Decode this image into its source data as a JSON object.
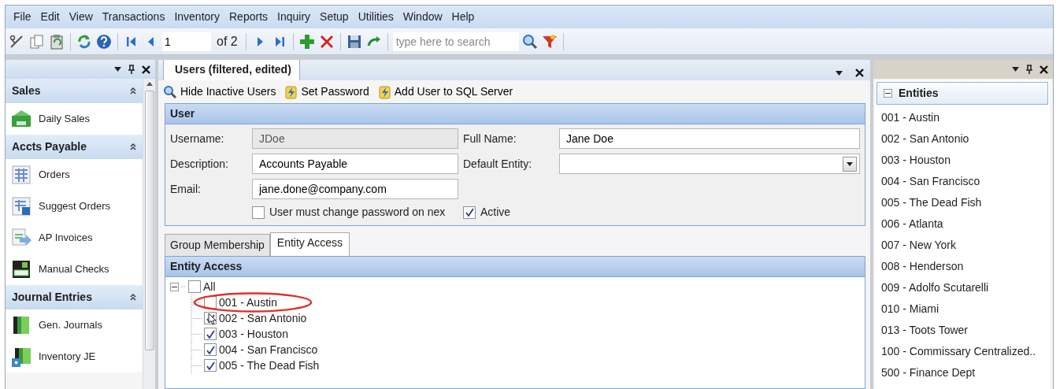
{
  "menu": [
    "File",
    "Edit",
    "View",
    "Transactions",
    "Inventory",
    "Reports",
    "Inquiry",
    "Setup",
    "Utilities",
    "Window",
    "Help"
  ],
  "toolbar": {
    "record": "1",
    "record_count": "of 2",
    "search": {
      "placeholder": "type here to search"
    }
  },
  "left_panel": {
    "groups": [
      {
        "title": "Sales",
        "expanded": true,
        "items": [
          "Daily Sales"
        ]
      },
      {
        "title": "Accts Payable",
        "expanded": true,
        "items": [
          "Orders",
          "Suggest Orders",
          "AP Invoices",
          "Manual Checks"
        ]
      },
      {
        "title": "Journal Entries",
        "expanded": true,
        "items": [
          "Gen. Journals",
          "Inventory JE"
        ]
      }
    ]
  },
  "document": {
    "tab": "Users (filtered, edited)",
    "actions": [
      "Hide Inactive Users",
      "Set Password",
      "Add User to SQL Server"
    ],
    "user": {
      "title": "User",
      "fields": [
        {
          "label": "Username:",
          "value": "JDoe",
          "disabled": true
        },
        {
          "label": "Full Name:",
          "value": "Jane Doe",
          "disabled": false
        },
        {
          "label": "Description:",
          "value": "Accounts Payable",
          "disabled": false
        },
        {
          "label": "Default Entity:",
          "kind": "dropdown",
          "disabled": false
        },
        {
          "label": "Email:",
          "value": "jane.done@company.com",
          "disabled": false
        }
      ],
      "checkboxes": [
        {
          "label": "User must change password on nex",
          "checked": false
        },
        {
          "label": "Active",
          "checked": true
        }
      ]
    },
    "subtabs": [
      {
        "label": "Group Membership",
        "selected": false
      },
      {
        "label": "Entity Access",
        "selected": true
      }
    ],
    "entity_access": {
      "title": "Entity Access",
      "tree": [
        {
          "label": "All",
          "checked": false,
          "expanded": true,
          "children": [
            {
              "label": "001 - Austin",
              "checked": false
            },
            {
              "label": "002 - San Antonio",
              "checked": true
            },
            {
              "label": "003 - Houston",
              "checked": true
            },
            {
              "label": "004 - San Francisco",
              "checked": true
            },
            {
              "label": "005 - The Dead Fish",
              "checked": true
            }
          ]
        }
      ]
    }
  },
  "right_panel": {
    "title": "Entities",
    "expanded": true,
    "items": [
      "001 - Austin",
      "002 - San Antonio",
      "003 - Houston",
      "004 - San Francisco",
      "005 - The Dead Fish",
      "006 - Atlanta",
      "007 - New York",
      "008 - Henderson",
      "009 - Adolfo Scutarelli",
      "010 - Miami",
      "013 - Toots Tower",
      "100 - Commissary Centralized..",
      "500 - Finance Dept"
    ]
  }
}
